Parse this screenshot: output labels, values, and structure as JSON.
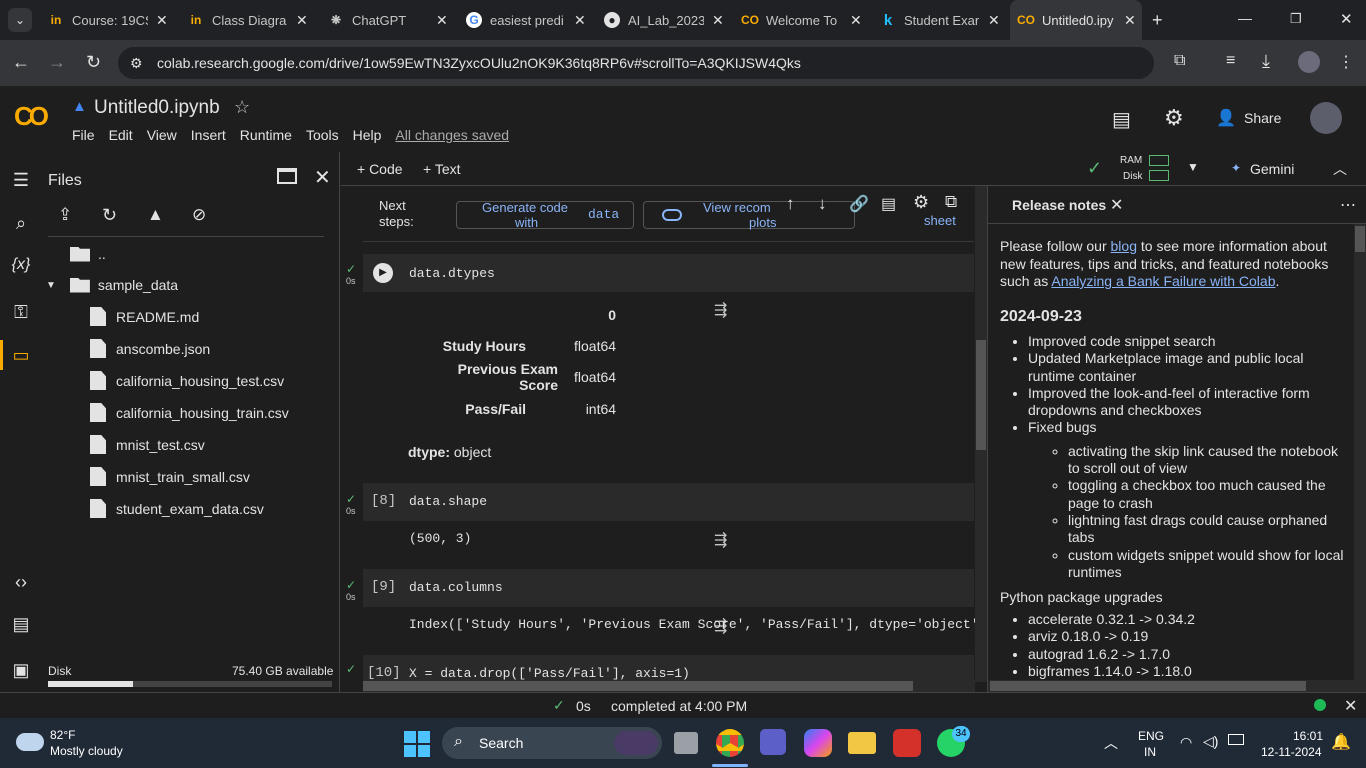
{
  "browser": {
    "tabs": [
      {
        "title": "Course: 19CS",
        "icon": "in"
      },
      {
        "title": "Class Diagra",
        "icon": "in"
      },
      {
        "title": "ChatGPT",
        "icon": "chatgpt"
      },
      {
        "title": "easiest predi",
        "icon": "google"
      },
      {
        "title": "AI_Lab_2023",
        "icon": "github"
      },
      {
        "title": "Welcome To",
        "icon": "colab"
      },
      {
        "title": "Student Exar",
        "icon": "k"
      },
      {
        "title": "Untitled0.ipy",
        "icon": "colab"
      }
    ],
    "url": "colab.research.google.com/drive/1ow59EwTN3ZyxcOUlu2nOK9K36tq8RP6v#scrollTo=A3QKIJSW4Qks"
  },
  "colab": {
    "notebook_title": "Untitled0.ipynb",
    "menu": [
      "File",
      "Edit",
      "View",
      "Insert",
      "Runtime",
      "Tools",
      "Help"
    ],
    "saved_status": "All changes saved",
    "share_label": "Share",
    "toolbar": {
      "code": "+ Code",
      "text": "+ Text",
      "ram": "RAM",
      "disk": "Disk",
      "gemini": "Gemini"
    }
  },
  "files_panel": {
    "title": "Files",
    "parent_dir": "..",
    "folder": "sample_data",
    "files": [
      "README.md",
      "anscombe.json",
      "california_housing_test.csv",
      "california_housing_train.csv",
      "mnist_test.csv",
      "mnist_train_small.csv",
      "student_exam_data.csv"
    ],
    "disk_label": "Disk",
    "disk_available": "75.40 GB available"
  },
  "notebook": {
    "next_steps": {
      "label1": "Next",
      "label2": "steps:",
      "btn1a": "Generate code",
      "btn1b": "with",
      "btn1_code": "data",
      "btn2a": "View recom",
      "btn2b": "plots",
      "btn3": "sheet"
    },
    "cells": [
      {
        "exec": "0s",
        "number": "",
        "code": "data.dtypes"
      },
      {
        "exec": "0s",
        "number": "[8]",
        "code": "data.shape",
        "output": "(500, 3)"
      },
      {
        "exec": "0s",
        "number": "[9]",
        "code": "data.columns",
        "output": "Index(['Study Hours', 'Previous Exam Score', 'Pass/Fail'], dtype='object')"
      },
      {
        "exec": "",
        "number": "[10]",
        "code": "X = data.drop(['Pass/Fail'], axis=1)"
      }
    ],
    "dtypes_table": {
      "header": "0",
      "rows": [
        {
          "name": "Study Hours",
          "type": "float64"
        },
        {
          "name": "Previous Exam Score",
          "type": "float64"
        },
        {
          "name": "Pass/Fail",
          "type": "int64"
        }
      ],
      "dtype_label": "dtype:",
      "dtype_value": "object"
    }
  },
  "release_notes": {
    "tab_title": "Release notes",
    "intro_1": "Please follow our",
    "link_blog": "blog",
    "intro_2": "to see more information about new features, tips and tricks, and featured notebooks such as",
    "link_featured": "Analyzing a Bank Failure with Colab",
    "date": "2024-09-23",
    "items": [
      "Improved code snippet search",
      "Updated Marketplace image and public local runtime container",
      "Improved the look-and-feel of interactive form dropdowns and checkboxes",
      "Fixed bugs"
    ],
    "subitems": [
      "activating the skip link caused the notebook to scroll out of view",
      "toggling a checkbox too much caused the page to crash",
      "lightning fast drags could cause orphaned tabs",
      "custom widgets snippet would show for local runtimes"
    ],
    "upgrades_title": "Python package upgrades",
    "upgrades": [
      "accelerate 0.32.1 -> 0.34.2",
      "arviz 0.18.0 -> 0.19",
      "autograd 1.6.2 -> 1.7.0",
      "bigframes 1.14.0 -> 1.18.0"
    ]
  },
  "status": {
    "exec_time": "0s",
    "completed": "completed at 4:00 PM"
  },
  "taskbar": {
    "weather_temp": "82°F",
    "weather_desc": "Mostly cloudy",
    "search": "Search",
    "lang1": "ENG",
    "lang2": "IN",
    "time": "16:01",
    "date": "12-11-2024",
    "whatsapp_badge": "34"
  },
  "colors": {
    "accent": "#f9ab00",
    "link": "#8ab4f8",
    "ok": "#5bb974"
  }
}
